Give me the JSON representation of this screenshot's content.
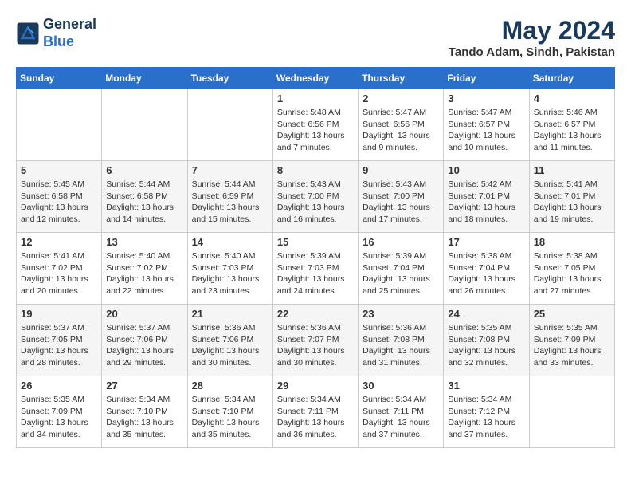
{
  "header": {
    "logo_line1": "General",
    "logo_line2": "Blue",
    "month": "May 2024",
    "location": "Tando Adam, Sindh, Pakistan"
  },
  "days_of_week": [
    "Sunday",
    "Monday",
    "Tuesday",
    "Wednesday",
    "Thursday",
    "Friday",
    "Saturday"
  ],
  "weeks": [
    [
      {
        "day": null
      },
      {
        "day": null
      },
      {
        "day": null
      },
      {
        "day": "1",
        "sunrise": "5:48 AM",
        "sunset": "6:56 PM",
        "daylight": "13 hours and 7 minutes."
      },
      {
        "day": "2",
        "sunrise": "5:47 AM",
        "sunset": "6:56 PM",
        "daylight": "13 hours and 9 minutes."
      },
      {
        "day": "3",
        "sunrise": "5:47 AM",
        "sunset": "6:57 PM",
        "daylight": "13 hours and 10 minutes."
      },
      {
        "day": "4",
        "sunrise": "5:46 AM",
        "sunset": "6:57 PM",
        "daylight": "13 hours and 11 minutes."
      }
    ],
    [
      {
        "day": "5",
        "sunrise": "5:45 AM",
        "sunset": "6:58 PM",
        "daylight": "13 hours and 12 minutes."
      },
      {
        "day": "6",
        "sunrise": "5:44 AM",
        "sunset": "6:58 PM",
        "daylight": "13 hours and 14 minutes."
      },
      {
        "day": "7",
        "sunrise": "5:44 AM",
        "sunset": "6:59 PM",
        "daylight": "13 hours and 15 minutes."
      },
      {
        "day": "8",
        "sunrise": "5:43 AM",
        "sunset": "7:00 PM",
        "daylight": "13 hours and 16 minutes."
      },
      {
        "day": "9",
        "sunrise": "5:43 AM",
        "sunset": "7:00 PM",
        "daylight": "13 hours and 17 minutes."
      },
      {
        "day": "10",
        "sunrise": "5:42 AM",
        "sunset": "7:01 PM",
        "daylight": "13 hours and 18 minutes."
      },
      {
        "day": "11",
        "sunrise": "5:41 AM",
        "sunset": "7:01 PM",
        "daylight": "13 hours and 19 minutes."
      }
    ],
    [
      {
        "day": "12",
        "sunrise": "5:41 AM",
        "sunset": "7:02 PM",
        "daylight": "13 hours and 20 minutes."
      },
      {
        "day": "13",
        "sunrise": "5:40 AM",
        "sunset": "7:02 PM",
        "daylight": "13 hours and 22 minutes."
      },
      {
        "day": "14",
        "sunrise": "5:40 AM",
        "sunset": "7:03 PM",
        "daylight": "13 hours and 23 minutes."
      },
      {
        "day": "15",
        "sunrise": "5:39 AM",
        "sunset": "7:03 PM",
        "daylight": "13 hours and 24 minutes."
      },
      {
        "day": "16",
        "sunrise": "5:39 AM",
        "sunset": "7:04 PM",
        "daylight": "13 hours and 25 minutes."
      },
      {
        "day": "17",
        "sunrise": "5:38 AM",
        "sunset": "7:04 PM",
        "daylight": "13 hours and 26 minutes."
      },
      {
        "day": "18",
        "sunrise": "5:38 AM",
        "sunset": "7:05 PM",
        "daylight": "13 hours and 27 minutes."
      }
    ],
    [
      {
        "day": "19",
        "sunrise": "5:37 AM",
        "sunset": "7:05 PM",
        "daylight": "13 hours and 28 minutes."
      },
      {
        "day": "20",
        "sunrise": "5:37 AM",
        "sunset": "7:06 PM",
        "daylight": "13 hours and 29 minutes."
      },
      {
        "day": "21",
        "sunrise": "5:36 AM",
        "sunset": "7:06 PM",
        "daylight": "13 hours and 30 minutes."
      },
      {
        "day": "22",
        "sunrise": "5:36 AM",
        "sunset": "7:07 PM",
        "daylight": "13 hours and 30 minutes."
      },
      {
        "day": "23",
        "sunrise": "5:36 AM",
        "sunset": "7:08 PM",
        "daylight": "13 hours and 31 minutes."
      },
      {
        "day": "24",
        "sunrise": "5:35 AM",
        "sunset": "7:08 PM",
        "daylight": "13 hours and 32 minutes."
      },
      {
        "day": "25",
        "sunrise": "5:35 AM",
        "sunset": "7:09 PM",
        "daylight": "13 hours and 33 minutes."
      }
    ],
    [
      {
        "day": "26",
        "sunrise": "5:35 AM",
        "sunset": "7:09 PM",
        "daylight": "13 hours and 34 minutes."
      },
      {
        "day": "27",
        "sunrise": "5:34 AM",
        "sunset": "7:10 PM",
        "daylight": "13 hours and 35 minutes."
      },
      {
        "day": "28",
        "sunrise": "5:34 AM",
        "sunset": "7:10 PM",
        "daylight": "13 hours and 35 minutes."
      },
      {
        "day": "29",
        "sunrise": "5:34 AM",
        "sunset": "7:11 PM",
        "daylight": "13 hours and 36 minutes."
      },
      {
        "day": "30",
        "sunrise": "5:34 AM",
        "sunset": "7:11 PM",
        "daylight": "13 hours and 37 minutes."
      },
      {
        "day": "31",
        "sunrise": "5:34 AM",
        "sunset": "7:12 PM",
        "daylight": "13 hours and 37 minutes."
      },
      {
        "day": null
      }
    ]
  ],
  "labels": {
    "sunrise": "Sunrise:",
    "sunset": "Sunset:",
    "daylight": "Daylight:"
  }
}
